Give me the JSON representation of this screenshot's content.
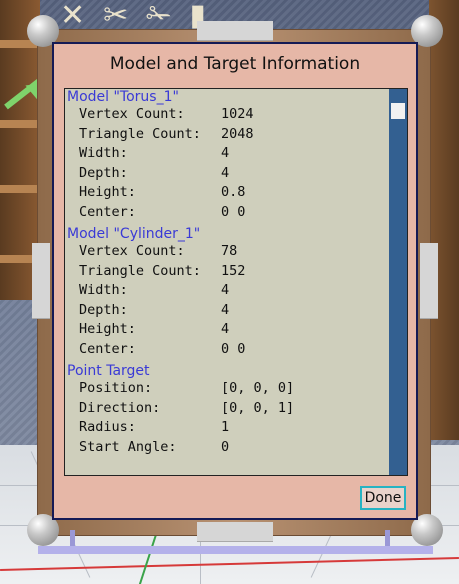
{
  "dialog": {
    "title": "Model and Target Information",
    "done_label": "Done"
  },
  "sections": [
    {
      "title": "Model \"Torus_1\"",
      "rows": [
        {
          "key": "Vertex Count:",
          "value": "1024"
        },
        {
          "key": "Triangle Count:",
          "value": "2048"
        },
        {
          "key": "Width:",
          "value": "4"
        },
        {
          "key": "Depth:",
          "value": "4"
        },
        {
          "key": "Height:",
          "value": "0.8"
        },
        {
          "key": "Center:",
          "value": "0 0"
        }
      ]
    },
    {
      "title": "Model \"Cylinder_1\"",
      "rows": [
        {
          "key": "Vertex Count:",
          "value": "78"
        },
        {
          "key": "Triangle Count:",
          "value": "152"
        },
        {
          "key": "Width:",
          "value": "4"
        },
        {
          "key": "Depth:",
          "value": "4"
        },
        {
          "key": "Height:",
          "value": "4"
        },
        {
          "key": "Center:",
          "value": "0 0"
        }
      ]
    },
    {
      "title": "Point Target",
      "rows": [
        {
          "key": "Position:",
          "value": "[0, 0, 0]"
        },
        {
          "key": "Direction:",
          "value": "[0, 0, 1]"
        },
        {
          "key": "Radius:",
          "value": "1"
        },
        {
          "key": "Start Angle:",
          "value": "0"
        }
      ]
    }
  ],
  "colors": {
    "dialog_bg": "#e6b7a7",
    "panel_bg": "#cfcfbc",
    "section_title": "#3a3ad6",
    "scrollbar": "#336091",
    "done_border": "#27b3c3"
  },
  "icons": {
    "background_decor": [
      "scissors-icon",
      "tool-icon"
    ],
    "arrow": "green-arrow-icon"
  }
}
